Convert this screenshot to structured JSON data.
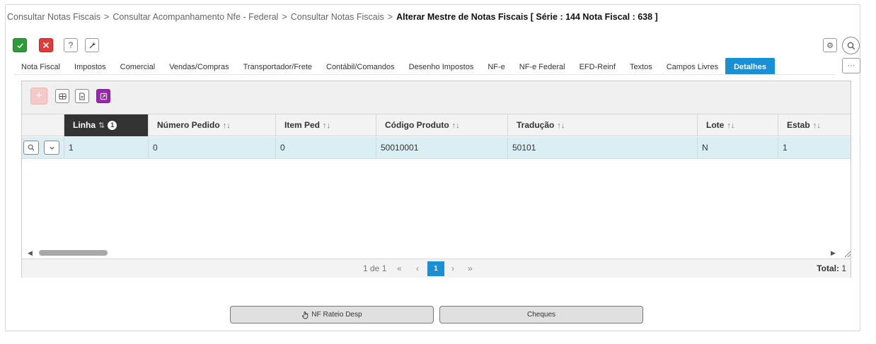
{
  "breadcrumb": {
    "items": [
      "Consultar Notas Fiscais",
      "Consultar Acompanhamento Nfe - Federal",
      "Consultar Notas Fiscais"
    ],
    "separator": ">",
    "current": "Alterar Mestre de Notas Fiscais [ Série : 144 Nota Fiscal : 638 ]"
  },
  "toolbar": {
    "confirm_icon": "check-icon",
    "cancel_icon": "close-icon",
    "help_label": "?",
    "tool_icon": "wrench-icon",
    "settings_icon": "gear-icon",
    "search_icon": "search-icon",
    "more_label": "···"
  },
  "tabs": [
    {
      "label": "Nota Fiscal"
    },
    {
      "label": "Impostos"
    },
    {
      "label": "Comercial"
    },
    {
      "label": "Vendas/Compras"
    },
    {
      "label": "Transportador/Frete"
    },
    {
      "label": "Contábil/Comandos"
    },
    {
      "label": "Desenho Impostos"
    },
    {
      "label": "NF-e"
    },
    {
      "label": "NF-e Federal"
    },
    {
      "label": "EFD-Reinf"
    },
    {
      "label": "Textos"
    },
    {
      "label": "Campos Livres"
    },
    {
      "label": "Detalhes",
      "active": true
    }
  ],
  "grid": {
    "add_label": "+",
    "columns": [
      {
        "label": "Linha",
        "sort_icon": "⇅",
        "badge": "1"
      },
      {
        "label": "Número Pedido",
        "sort_icon": "↑↓"
      },
      {
        "label": "Item Ped",
        "sort_icon": "↑↓"
      },
      {
        "label": "Código Produto",
        "sort_icon": "↑↓"
      },
      {
        "label": "Tradução",
        "sort_icon": "↑↓"
      },
      {
        "label": "Lote",
        "sort_icon": "↑↓"
      },
      {
        "label": "Estab",
        "sort_icon": "↑↓"
      }
    ],
    "rows": [
      {
        "linha": "1",
        "numero_pedido": "0",
        "item_ped": "0",
        "codigo_produto": "50010001",
        "traducao": "50101",
        "lote": "N",
        "estab": "1"
      }
    ],
    "row_actions": {
      "view_icon": "search-icon",
      "expand_icon": "chevron-down-icon"
    }
  },
  "pager": {
    "text": "1 de 1",
    "first": "«",
    "prev": "‹",
    "current": "1",
    "next": "›",
    "last": "»",
    "total_label": "Total:",
    "total_value": "1"
  },
  "buttons": {
    "rateio": "NF Rateio Desp",
    "cheques": "Cheques"
  },
  "colors": {
    "accent": "#1a8fd4",
    "confirm": "#2e9a3a",
    "cancel": "#e03a3a",
    "export": "#9b27b0",
    "row_selected": "#dbeef4"
  }
}
